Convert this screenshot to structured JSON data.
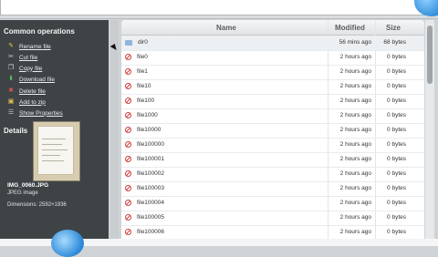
{
  "sidebar": {
    "common_title": "Common operations",
    "operations": [
      {
        "label": "Rename file",
        "icon": "rename-icon"
      },
      {
        "label": "Cut file",
        "icon": "cut-icon"
      },
      {
        "label": "Copy file",
        "icon": "copy-icon"
      },
      {
        "label": "Download file",
        "icon": "download-icon"
      },
      {
        "label": "Delete file",
        "icon": "delete-icon"
      },
      {
        "label": "Add to zip",
        "icon": "zip-icon"
      },
      {
        "label": "Show Properties",
        "icon": "properties-icon"
      }
    ],
    "details_title": "Details",
    "details": {
      "name": "IMG_0060.JPG",
      "type": "JPEG image",
      "dimensions": "Dimensions: 2592×1936"
    }
  },
  "table": {
    "headers": {
      "name": "Name",
      "modified": "Modified",
      "size": "Size"
    },
    "rows": [
      {
        "name": "dir0",
        "modified": "56 mins ago",
        "size": "68 bytes",
        "kind": "folder"
      },
      {
        "name": "file0",
        "modified": "2 hours ago",
        "size": "0 bytes",
        "kind": "file"
      },
      {
        "name": "file1",
        "modified": "2 hours ago",
        "size": "0 bytes",
        "kind": "file"
      },
      {
        "name": "file10",
        "modified": "2 hours ago",
        "size": "0 bytes",
        "kind": "file"
      },
      {
        "name": "file100",
        "modified": "2 hours ago",
        "size": "0 bytes",
        "kind": "file"
      },
      {
        "name": "file1000",
        "modified": "2 hours ago",
        "size": "0 bytes",
        "kind": "file"
      },
      {
        "name": "file10000",
        "modified": "2 hours ago",
        "size": "0 bytes",
        "kind": "file"
      },
      {
        "name": "file100000",
        "modified": "2 hours ago",
        "size": "0 bytes",
        "kind": "file"
      },
      {
        "name": "file100001",
        "modified": "2 hours ago",
        "size": "0 bytes",
        "kind": "file"
      },
      {
        "name": "file100002",
        "modified": "2 hours ago",
        "size": "0 bytes",
        "kind": "file"
      },
      {
        "name": "file100003",
        "modified": "2 hours ago",
        "size": "0 bytes",
        "kind": "file"
      },
      {
        "name": "file100004",
        "modified": "2 hours ago",
        "size": "0 bytes",
        "kind": "file"
      },
      {
        "name": "file100005",
        "modified": "2 hours ago",
        "size": "0 bytes",
        "kind": "file"
      },
      {
        "name": "file100006",
        "modified": "2 hours ago",
        "size": "0 bytes",
        "kind": "file"
      }
    ]
  },
  "colors": {
    "sidebar_bg": "#3e4346",
    "accent": "#2b88d8"
  }
}
